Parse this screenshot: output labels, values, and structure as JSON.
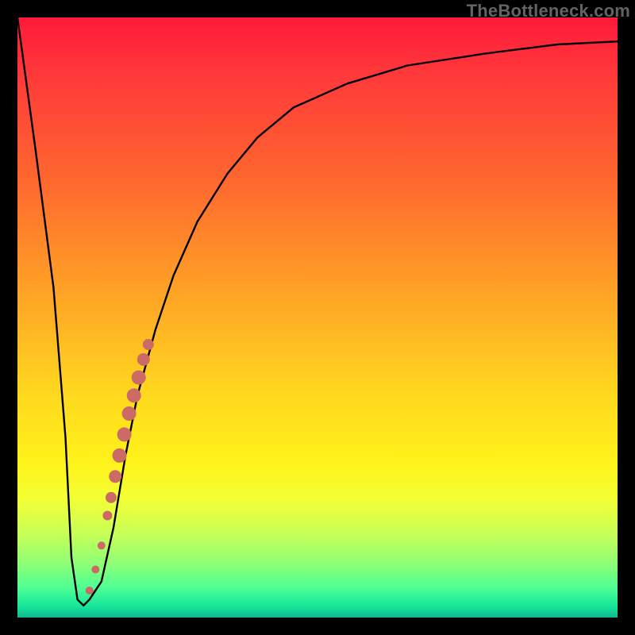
{
  "watermark": "TheBottleneck.com",
  "chart_data": {
    "type": "line",
    "title": "",
    "xlabel": "",
    "ylabel": "",
    "xlim": [
      0,
      100
    ],
    "ylim": [
      0,
      100
    ],
    "grid": false,
    "legend": false,
    "background_gradient": {
      "direction": "vertical",
      "stops": [
        {
          "pos": 0.0,
          "color": "#ff1a3a"
        },
        {
          "pos": 0.28,
          "color": "#ff6a2e"
        },
        {
          "pos": 0.62,
          "color": "#ffd61f"
        },
        {
          "pos": 0.8,
          "color": "#f4ff33"
        },
        {
          "pos": 0.95,
          "color": "#4fff94"
        },
        {
          "pos": 1.0,
          "color": "#0db98f"
        }
      ]
    },
    "series": [
      {
        "name": "bottleneck-curve",
        "color": "#000000",
        "x": [
          0,
          3,
          6,
          8,
          9,
          10,
          11,
          12,
          14,
          16,
          18,
          20,
          23,
          26,
          30,
          35,
          40,
          46,
          55,
          65,
          78,
          90,
          100
        ],
        "y": [
          100,
          78,
          55,
          30,
          10,
          3,
          2,
          3,
          6,
          15,
          27,
          37,
          48,
          57,
          66,
          74,
          80,
          85,
          89,
          92,
          94,
          95.5,
          96
        ]
      }
    ],
    "markers": [
      {
        "name": "highlight-band",
        "color": "#cc6a66",
        "shape": "circle",
        "points": [
          {
            "x": 12.0,
            "y": 4.5,
            "r": 5
          },
          {
            "x": 13.0,
            "y": 8.0,
            "r": 5
          },
          {
            "x": 14.0,
            "y": 12.0,
            "r": 5
          },
          {
            "x": 15.0,
            "y": 17.0,
            "r": 6
          },
          {
            "x": 15.6,
            "y": 20.0,
            "r": 7
          },
          {
            "x": 16.3,
            "y": 23.5,
            "r": 8
          },
          {
            "x": 17.0,
            "y": 27.0,
            "r": 9
          },
          {
            "x": 17.8,
            "y": 30.5,
            "r": 9
          },
          {
            "x": 18.6,
            "y": 34.0,
            "r": 9
          },
          {
            "x": 19.4,
            "y": 37.0,
            "r": 9
          },
          {
            "x": 20.2,
            "y": 40.0,
            "r": 9
          },
          {
            "x": 21.0,
            "y": 43.0,
            "r": 8
          },
          {
            "x": 21.8,
            "y": 45.5,
            "r": 7
          }
        ]
      }
    ]
  }
}
